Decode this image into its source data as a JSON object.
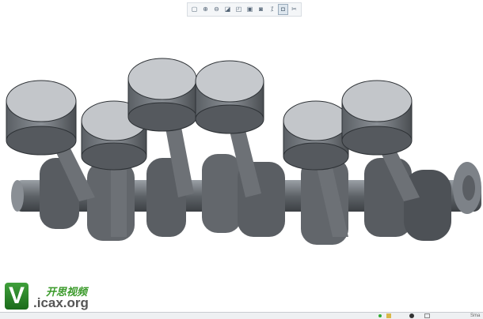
{
  "toolbar": {
    "icons": [
      "refit-icon",
      "zoom-in-icon",
      "zoom-out-icon",
      "repaint-icon",
      "view-orientation-icon",
      "saved-views-icon",
      "display-style-icon",
      "datum-display-icon",
      "spin-center-icon",
      "annotation-icon"
    ],
    "glyphs": [
      "▢",
      "⊕",
      "⊖",
      "◪",
      "◰",
      "▣",
      "◙",
      "⁒",
      "◘",
      "✂"
    ]
  },
  "watermark": {
    "logo_letter": "V",
    "name_cn": "开思视频",
    "url": ".icax.org"
  },
  "statusbar": {
    "text": "Sma"
  },
  "colors": {
    "model": "#6f7378",
    "background": "#ffffff",
    "brand_green": "#2e8b2e"
  }
}
